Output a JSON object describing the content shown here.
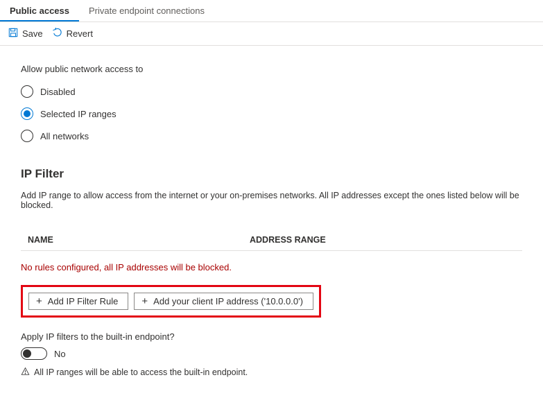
{
  "tabs": [
    {
      "label": "Public access",
      "active": true
    },
    {
      "label": "Private endpoint connections",
      "active": false
    }
  ],
  "toolbar": {
    "save_label": "Save",
    "revert_label": "Revert"
  },
  "public_access": {
    "group_label": "Allow public network access to",
    "options": {
      "disabled": "Disabled",
      "selected_ip": "Selected IP ranges",
      "all": "All networks"
    },
    "selected": "selected_ip"
  },
  "ip_filter": {
    "heading": "IP Filter",
    "description": "Add IP range to allow access from the internet or your on-premises networks. All IP addresses except the ones listed below will be blocked.",
    "columns": {
      "name": "NAME",
      "range": "ADDRESS RANGE"
    },
    "empty_message": "No rules configured, all IP addresses will be blocked.",
    "add_rule_label": "Add IP Filter Rule",
    "add_client_ip_label": "Add your client IP address ('10.0.0.0')"
  },
  "apply_builtin": {
    "label": "Apply IP filters to the built-in endpoint?",
    "value_label": "No",
    "info_text": "All IP ranges will be able to access the built-in endpoint."
  }
}
